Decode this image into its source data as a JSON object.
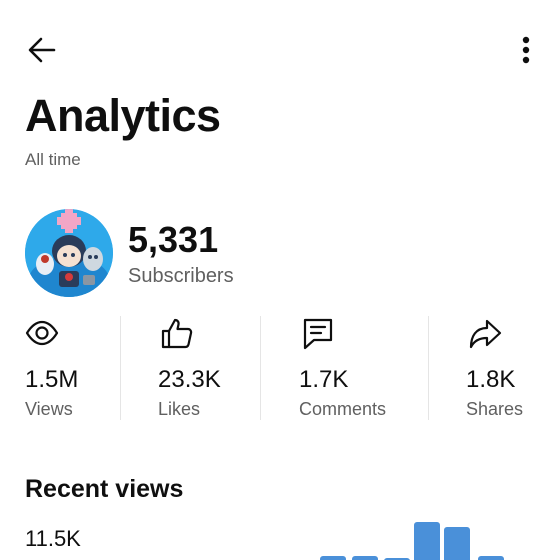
{
  "header": {
    "title": "Analytics",
    "subtitle": "All time",
    "back_icon": "arrow-left-icon",
    "more_icon": "more-vertical-icon"
  },
  "channel": {
    "subscriber_count": "5,331",
    "subscriber_label": "Subscribers"
  },
  "stats": [
    {
      "icon": "eye-icon",
      "value": "1.5M",
      "label": "Views"
    },
    {
      "icon": "thumbs-up-icon",
      "value": "23.3K",
      "label": "Likes"
    },
    {
      "icon": "comment-icon",
      "value": "1.7K",
      "label": "Comments"
    },
    {
      "icon": "share-icon",
      "value": "1.8K",
      "label": "Shares"
    }
  ],
  "recent": {
    "title": "Recent views",
    "value": "11.5K"
  },
  "colors": {
    "bar": "#4a90d9",
    "text_primary": "#0f0f0f",
    "text_secondary": "#606060"
  }
}
